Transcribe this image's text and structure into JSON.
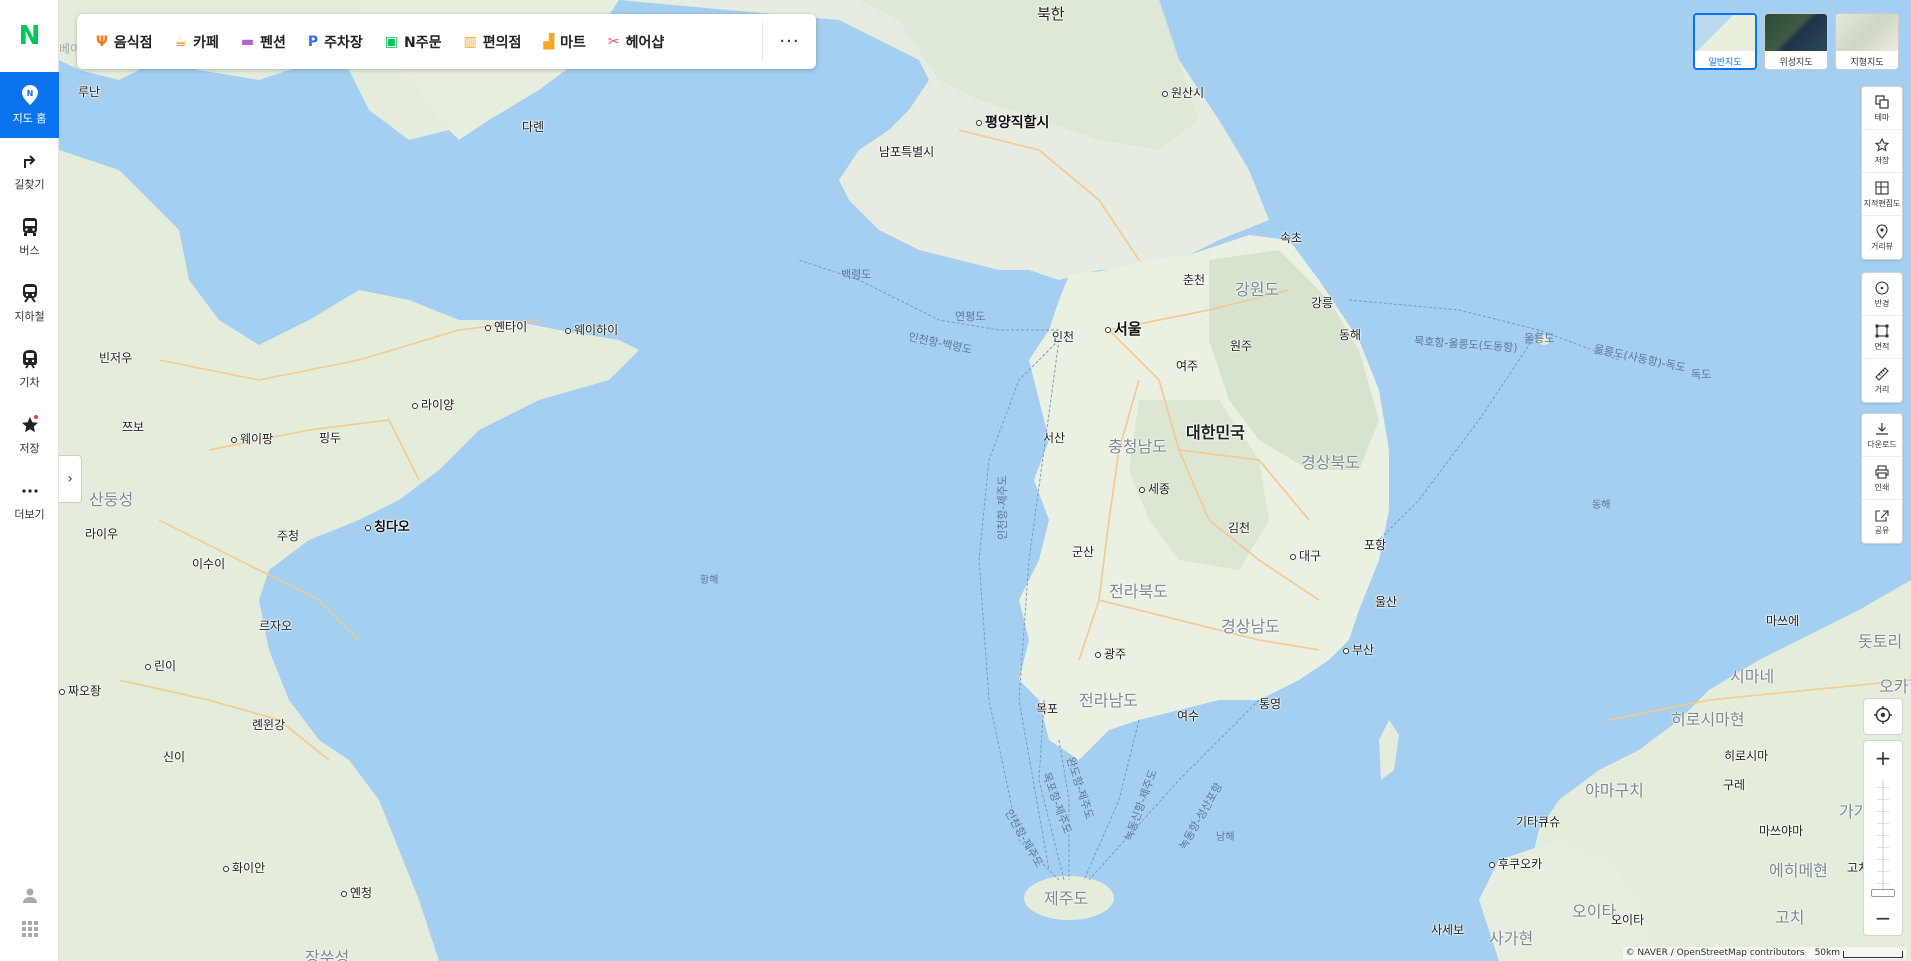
{
  "brand": {
    "logo": "N",
    "color": "#03c75a"
  },
  "sidebar": {
    "items": [
      {
        "label": "지도 홈",
        "icon": "map-pin-n-icon",
        "active": true
      },
      {
        "label": "길찾기",
        "icon": "directions-arrow-icon"
      },
      {
        "label": "버스",
        "icon": "bus-icon"
      },
      {
        "label": "지하철",
        "icon": "subway-icon"
      },
      {
        "label": "기차",
        "icon": "train-icon"
      },
      {
        "label": "저장",
        "icon": "star-icon",
        "badge_dot": true
      },
      {
        "label": "더보기",
        "icon": "more-dots-icon"
      }
    ],
    "bottom": [
      "user-icon",
      "apps-grid-icon"
    ]
  },
  "categories": {
    "items": [
      {
        "label": "음식점",
        "icon": "restaurant-icon",
        "color": "#f47d20"
      },
      {
        "label": "카페",
        "icon": "cafe-icon",
        "color": "#f47d20"
      },
      {
        "label": "펜션",
        "icon": "bed-icon",
        "color": "#b65fd4"
      },
      {
        "label": "주차장",
        "icon": "parking-icon",
        "color": "#2b6cf0"
      },
      {
        "label": "N주문",
        "icon": "order-bag-icon",
        "color": "#03c75a"
      },
      {
        "label": "편의점",
        "icon": "store-icon",
        "color": "#f5a623"
      },
      {
        "label": "마트",
        "icon": "cart-icon",
        "color": "#f5a623"
      },
      {
        "label": "헤어샵",
        "icon": "scissors-icon",
        "color": "#e8505b"
      }
    ],
    "more": "···"
  },
  "map_types": [
    {
      "label": "일반지도",
      "active": true
    },
    {
      "label": "위성지도"
    },
    {
      "label": "지형지도"
    }
  ],
  "tools_group1": [
    {
      "label": "테마",
      "icon": "layers-icon"
    },
    {
      "label": "저장",
      "icon": "star-outline-icon"
    },
    {
      "label": "지적편집도",
      "icon": "cadastral-icon"
    },
    {
      "label": "거리뷰",
      "icon": "streetview-pin-icon"
    }
  ],
  "tools_group2": [
    {
      "label": "반경",
      "icon": "radius-icon"
    },
    {
      "label": "면적",
      "icon": "area-icon"
    },
    {
      "label": "거리",
      "icon": "ruler-icon"
    }
  ],
  "tools_group3": [
    {
      "label": "다운로드",
      "icon": "download-icon"
    },
    {
      "label": "인쇄",
      "icon": "print-icon"
    },
    {
      "label": "공유",
      "icon": "share-icon"
    }
  ],
  "zoom": {
    "in": "+",
    "out": "−",
    "level_fraction": 0.05
  },
  "attribution": "© NAVER / OpenStreetMap contributors",
  "scale": "50km",
  "map_labels": {
    "north_korea": "북한",
    "wonsan": "원산시",
    "pyongyang": "평양직할시",
    "nampo": "남포특별시",
    "dalian": "다롄",
    "lushun": "루난",
    "baengnyeong": "백령도",
    "yeonpyeong": "연평도",
    "incheon": "인천",
    "seoul": "서울",
    "sokcho": "속초",
    "chuncheon": "춘천",
    "gangwon": "강원도",
    "gangneung": "강릉",
    "donghae": "동해",
    "wonju": "원주",
    "yeoju": "여주",
    "korea": "대한민국",
    "chungnam": "충청남도",
    "seosan": "서산",
    "sejong": "세종",
    "gyeongbuk": "경상북도",
    "gimcheon": "김천",
    "pohang": "포항",
    "daegu": "대구",
    "gunsan": "군산",
    "jeonbuk": "전라북도",
    "gyeongnam": "경상남도",
    "ulsan": "울산",
    "busan": "부산",
    "gwangju": "광주",
    "jeonnam": "전라남도",
    "mokpo": "목포",
    "yeosu": "여수",
    "tongyeong": "통영",
    "jeju": "제주도",
    "yantai": "옌타이",
    "weihai": "웨이하이",
    "binzhou": "빈저우",
    "laiyang": "라이양",
    "zibo": "쯔보",
    "weifang": "웨이팡",
    "pingdu": "핑두",
    "shandong": "산둥성",
    "qingdao": "칭다오",
    "laiwu": "라이우",
    "zhucheng": "주청",
    "yishui": "이수이",
    "rizhao": "르자오",
    "linyi": "린이",
    "zaozhuang": "짜오좡",
    "lianyungang": "롄윈강",
    "xinyi": "신이",
    "huaian": "화이안",
    "yancheng": "옌청",
    "jiangsu": "장쑤성",
    "hebei_edge": "베이징",
    "yellow_sea": "황해",
    "east_sea": "동해",
    "south_sea": "남해",
    "matsue": "마쓰에",
    "tottori": "돗토리",
    "shimane": "시마네",
    "hiroshima_pref": "히로시마현",
    "hiroshima": "히로시마",
    "kure": "구레",
    "yamaguchi": "야마구치",
    "matsuyama": "마쓰야마",
    "ehime": "에히메현",
    "kochi": "고치",
    "kochi_pref": "고치",
    "kagawa": "가가",
    "kitakyushu": "기타큐슈",
    "fukuoka": "후쿠오카",
    "oita_pref": "오이타",
    "oita": "오이타",
    "saga": "사세보",
    "saga_pref": "사가현",
    "okayama": "오카",
    "ferry_mukho": "묵호항-울릉도(도동항)",
    "ferry_ulleung": "울릉도(사동항)-독도",
    "ferry_incheon_baeng": "인천항-백령도",
    "ferry_incheon_jeju1": "인천항-제주도",
    "ferry_incheon_jeju2": "인천항-제주도",
    "ferry_mokpo_jeju": "목포항-제주도",
    "ferry_wando_jeju": "완도항-제주도",
    "ferry_nokdong_jeju": "녹동신항-제주도",
    "ferry_nokdong_seongsan": "녹동항-성산포항",
    "ulleung": "울릉도",
    "dokdo": "독도"
  }
}
